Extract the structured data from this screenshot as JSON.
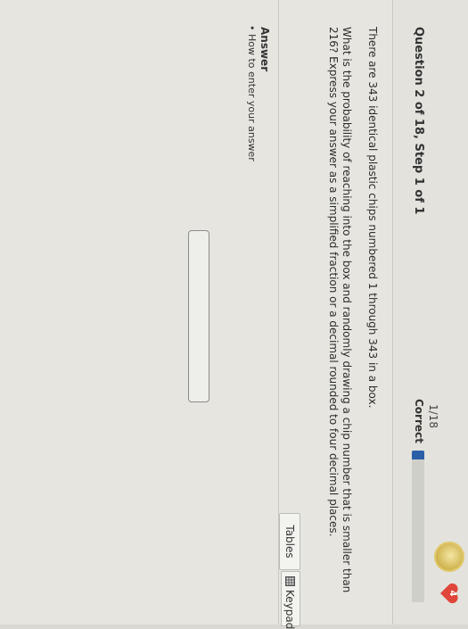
{
  "header": {
    "question_title": "Question 2 of 18, Step 1 of 1",
    "progress_fraction": "1/18",
    "progress_status": "Correct",
    "progress_value": 0.06,
    "progress_color": "#2a5fa8",
    "coin_icon": "achievement-coin-icon",
    "heart_icon": "heart-icon",
    "heart_color": "#e0473a",
    "lives": "4"
  },
  "question": {
    "line1": "There are 343 identical plastic chips numbered 1 through 343 in a box.",
    "line2": "What is the probability of reaching into the box and randomly drawing a chip number that is smaller than 216? Express your answer as a simplified fraction or a decimal rounded to four decimal places."
  },
  "tools": {
    "tables_label": "Tables",
    "keypad_label": "Keypad",
    "keypad_icon": "keypad-grid-icon"
  },
  "answer": {
    "label": "Answer",
    "help_link": "How to enter your answer",
    "input_value": ""
  }
}
